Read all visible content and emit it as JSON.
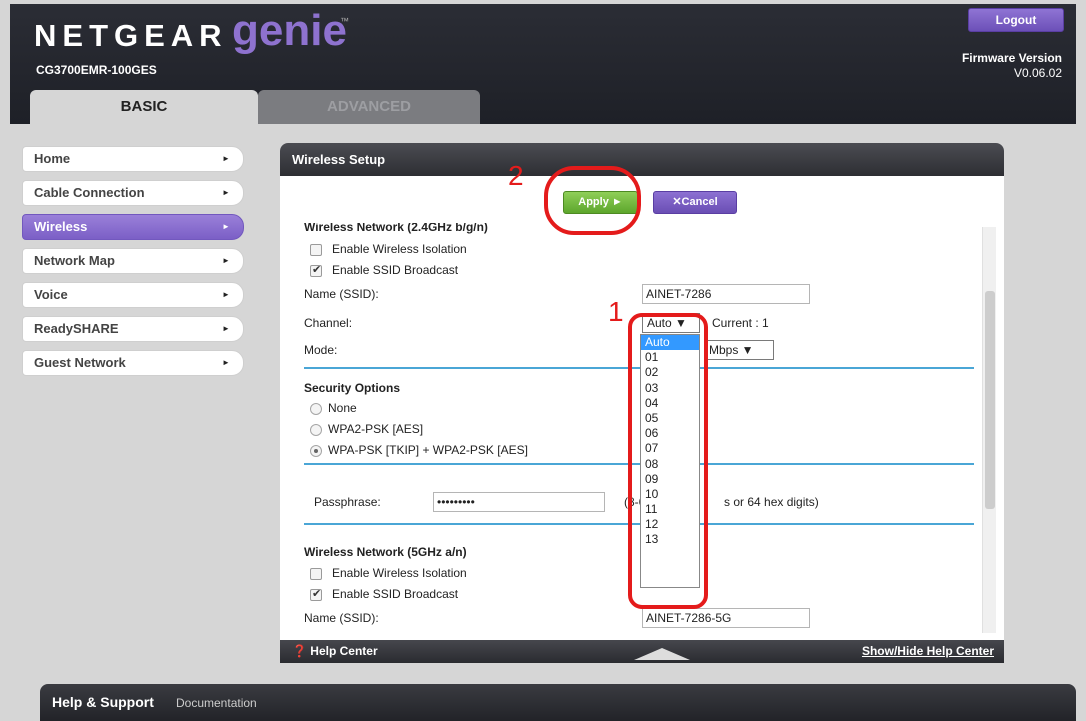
{
  "brand": {
    "name": "NETGEAR",
    "product": "genie",
    "tm": "™",
    "model": "CG3700EMR-100GES"
  },
  "header": {
    "logout": "Logout",
    "firmware_label": "Firmware Version",
    "firmware_value": "V0.06.02",
    "tabs": [
      "BASIC",
      "ADVANCED"
    ]
  },
  "menu": {
    "items": [
      {
        "label": "Home"
      },
      {
        "label": "Cable Connection"
      },
      {
        "label": "Wireless",
        "active": true
      },
      {
        "label": "Network Map"
      },
      {
        "label": "Voice"
      },
      {
        "label": "ReadySHARE"
      },
      {
        "label": "Guest Network"
      }
    ],
    "arrow": "►"
  },
  "panel": {
    "title": "Wireless Setup",
    "apply": "Apply ►",
    "cancel": "✕Cancel",
    "net24": {
      "heading": "Wireless Network (2.4GHz b/g/n)",
      "isolation": "Enable Wireless Isolation",
      "broadcast": "Enable SSID Broadcast",
      "name_label": "Name (SSID):",
      "name_value": "AINET-7286",
      "channel_label": "Channel:",
      "channel_value": "Auto ▼",
      "current": "Current : 1",
      "mode_label": "Mode:",
      "mode_value": "Mbps ▼"
    },
    "security": {
      "heading": "Security Options",
      "options": [
        "None",
        "WPA2-PSK [AES]",
        "WPA-PSK [TKIP] + WPA2-PSK [AES]"
      ],
      "selected_index": 2
    },
    "pass": {
      "label": "Passphrase:",
      "value": "•••••••••",
      "hint_prefix": "(8-63",
      "hint_suffix": "s or 64 hex digits)"
    },
    "net5": {
      "heading": "Wireless Network (5GHz a/n)",
      "isolation": "Enable Wireless Isolation",
      "broadcast": "Enable SSID Broadcast",
      "name_label": "Name (SSID):",
      "name_value": "AINET-7286-5G"
    },
    "help_center": "Help Center",
    "show_hide": "Show/Hide Help Center"
  },
  "channel_dropdown": {
    "options": [
      "Auto",
      "01",
      "02",
      "03",
      "04",
      "05",
      "06",
      "07",
      "08",
      "09",
      "10",
      "11",
      "12",
      "13"
    ],
    "highlighted_index": 0
  },
  "annotations": {
    "one": "1",
    "two": "2",
    "color": "#e41b1b"
  },
  "footer": {
    "title": "Help & Support",
    "link": "Documentation"
  },
  "colors": {
    "accent_purple": "#7b5fc6",
    "apply_green": "#6cb63a",
    "rule_blue": "#4aa6d6"
  }
}
